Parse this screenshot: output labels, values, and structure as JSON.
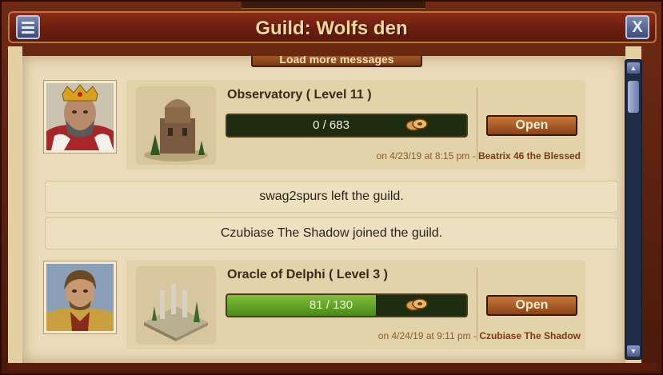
{
  "window": {
    "title": "Guild: Wolfs den",
    "menu_icon": "hamburger-icon",
    "close_label": "X"
  },
  "chat": {
    "load_more_label": "Load more messages",
    "entries": [
      {
        "building": "Observatory ( Level 11 )",
        "progress_text": "0 / 683",
        "progress_fraction": 0,
        "open_label": "Open",
        "timestamp": "on 4/23/19 at 8:15 pm - ",
        "author": "Beatrix 46 the Blessed"
      },
      {
        "building": "Oracle of Delphi ( Level 3 )",
        "progress_text": "81 / 130",
        "progress_fraction": 0.623,
        "open_label": "Open",
        "timestamp": "on 4/24/19 at 9:11 pm - ",
        "author": "Czubiase The Shadow"
      }
    ],
    "system_messages": [
      "swag2spurs left the guild.",
      "Czubiase The Shadow joined the guild."
    ]
  },
  "colors": {
    "progress_fill": "#6aab2a",
    "progress_empty": "#1e2c10",
    "button": "#a85a28",
    "title": "#f3d89a"
  }
}
